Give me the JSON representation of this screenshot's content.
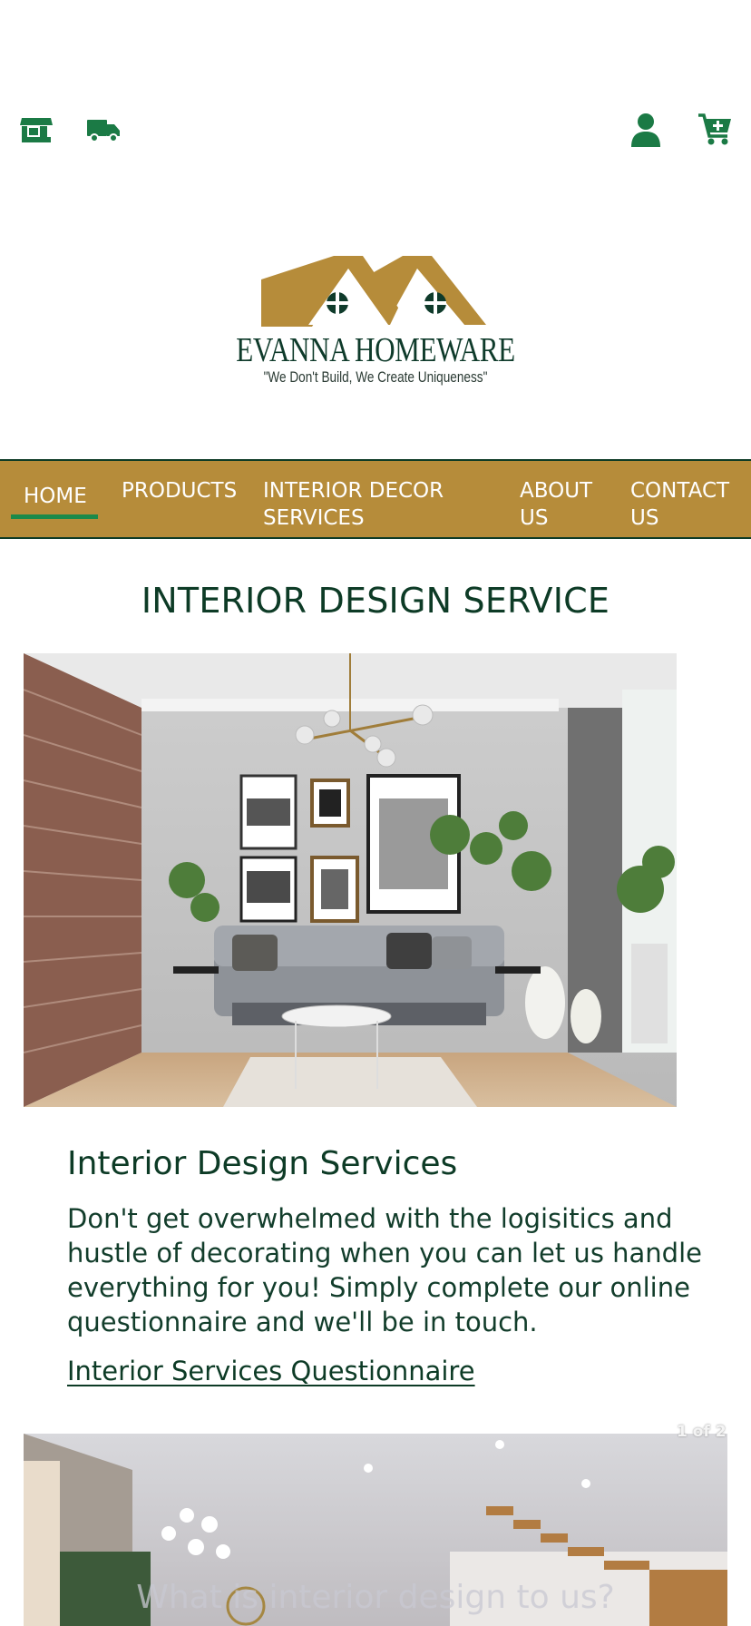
{
  "header": {
    "icons": [
      "store-icon",
      "truck-icon",
      "user-icon",
      "cart-plus-icon"
    ],
    "icon_color": "#1b7a45"
  },
  "brand": {
    "name": "EVANNA HOMEWARE",
    "tagline": "\"We Don't Build, We Create Uniqueness\"",
    "logo_color": "#b68c3a"
  },
  "nav": {
    "background": "#b68c3a",
    "active_indicator": "#1b8a4a",
    "items": [
      {
        "label": "HOME"
      },
      {
        "label": "PRODUCTS"
      },
      {
        "label": "INTERIOR DECOR SERVICES"
      },
      {
        "label": "ABOUT US"
      },
      {
        "label": "CONTACT US"
      }
    ]
  },
  "main": {
    "page_title": "INTERIOR DESIGN SERVICE",
    "section_title": "Interior Design Services",
    "section_body": "Don't get overwhelmed with the logisitics and hustle of decorating when you can let us handle everything for you! Simply complete our online questionnaire and we'll be in touch.",
    "questionnaire_link": "Interior Services Questionnaire"
  },
  "carousel": {
    "counter": "1 of 2",
    "caption": "What is interior design to us?"
  }
}
